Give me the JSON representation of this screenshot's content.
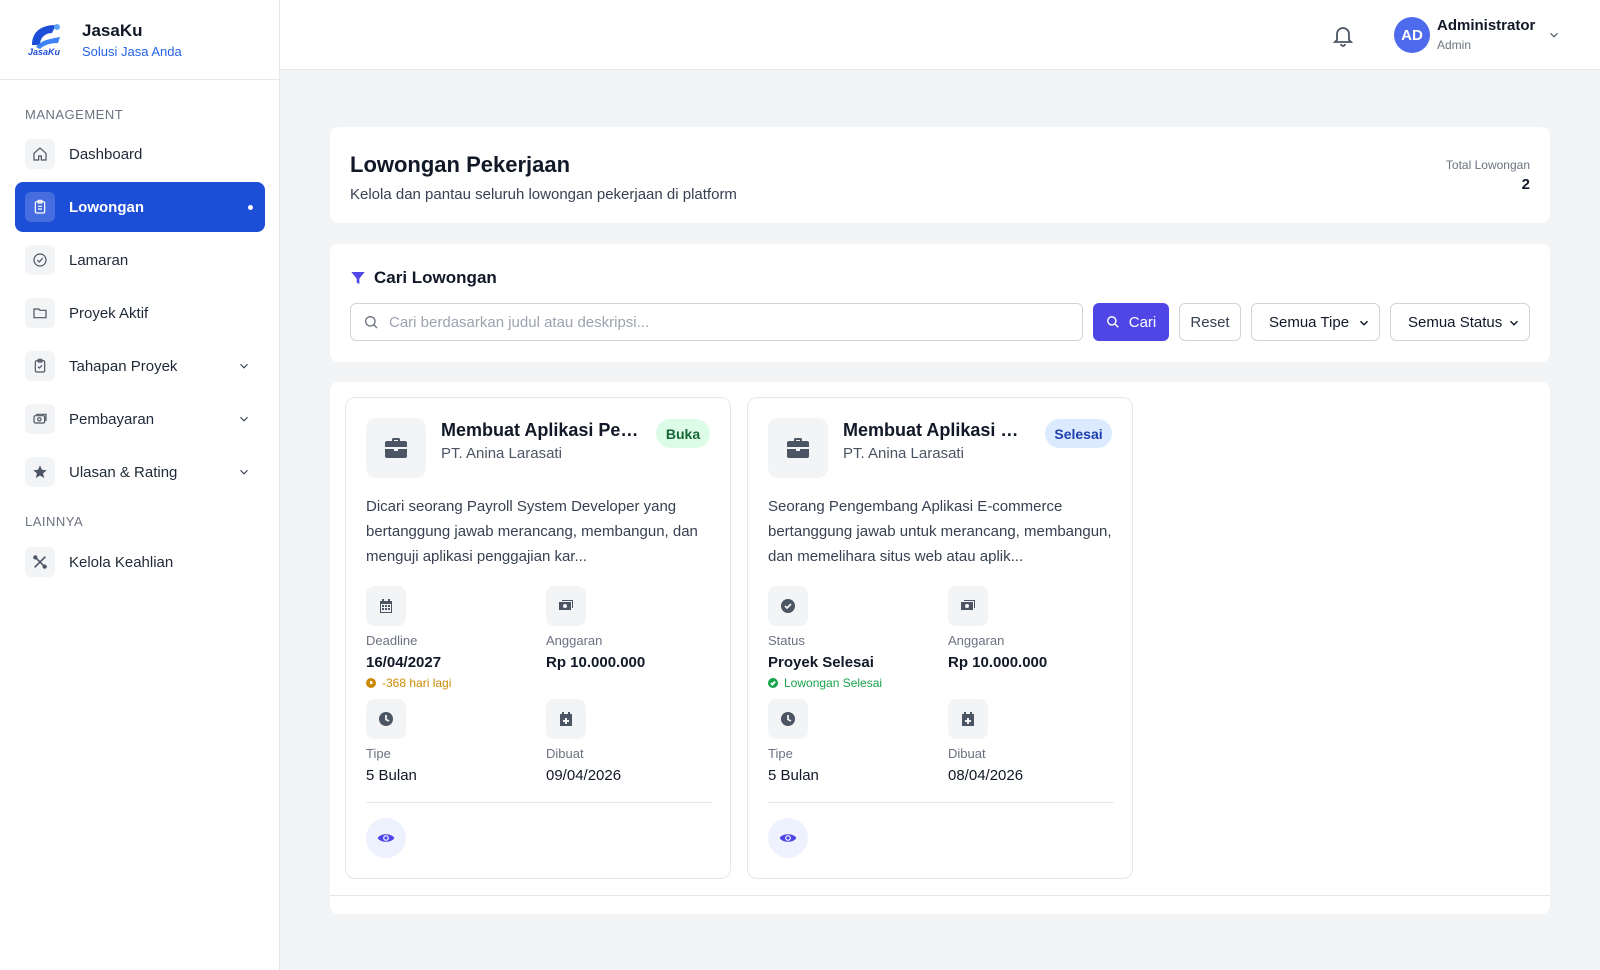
{
  "brand": {
    "name": "JasaKu",
    "tagline": "Solusi Jasa Anda",
    "logo_text": "JasaKu"
  },
  "sidebar": {
    "section_management": "MANAGEMENT",
    "section_other": "LAINNYA",
    "items": [
      {
        "label": "Dashboard",
        "icon": "home-icon"
      },
      {
        "label": "Lowongan",
        "icon": "clipboard-icon",
        "active": true
      },
      {
        "label": "Lamaran",
        "icon": "check-circle-icon"
      },
      {
        "label": "Proyek Aktif",
        "icon": "folder-icon"
      },
      {
        "label": "Tahapan Proyek",
        "icon": "clipboard-check-icon",
        "expandable": true
      },
      {
        "label": "Pembayaran",
        "icon": "money-icon",
        "expandable": true
      },
      {
        "label": "Ulasan & Rating",
        "icon": "star-icon",
        "expandable": true
      },
      {
        "label": "Kelola Keahlian",
        "icon": "tools-icon"
      }
    ]
  },
  "topbar": {
    "avatar_initials": "AD",
    "user_name": "Administrator",
    "user_role": "Admin"
  },
  "header": {
    "title": "Lowongan Pekerjaan",
    "subtitle": "Kelola dan pantau seluruh lowongan pekerjaan di platform",
    "total_label": "Total Lowongan",
    "total_value": "2"
  },
  "search": {
    "title": "Cari Lowongan",
    "placeholder": "Cari berdasarkan judul atau deskripsi...",
    "value": "",
    "search_button": "Cari",
    "reset_button": "Reset",
    "type_filter": "Semua Tipe",
    "status_filter": "Semua Status"
  },
  "jobs": [
    {
      "title": "Membuat Aplikasi Peng...",
      "company": "PT. Anina Larasati",
      "badge": "Buka",
      "description": "Dicari seorang Payroll System Developer yang bertanggung jawab merancang, membangun, dan menguji aplikasi penggajian kar...",
      "meta1_label": "Deadline",
      "meta1_value": "16/04/2027",
      "meta1_note": "-368 hari lagi",
      "budget_label": "Anggaran",
      "budget_value": "Rp 10.000.000",
      "type_label": "Tipe",
      "type_value": "5 Bulan",
      "created_label": "Dibuat",
      "created_value": "09/04/2026"
    },
    {
      "title": "Membuat Aplikasi We...",
      "company": "PT. Anina Larasati",
      "badge": "Selesai",
      "description": "Seorang Pengembang Aplikasi E-commerce bertanggung jawab untuk merancang, membangun, dan memelihara situs web atau aplik...",
      "meta1_label": "Status",
      "meta1_value": "Proyek Selesai",
      "meta1_note": "Lowongan Selesai",
      "budget_label": "Anggaran",
      "budget_value": "Rp 10.000.000",
      "type_label": "Tipe",
      "type_value": "5 Bulan",
      "created_label": "Dibuat",
      "created_value": "08/04/2026"
    }
  ],
  "colors": {
    "primary": "#1d4ed8",
    "accent": "#4f46e5",
    "open_badge": "#dcfce7",
    "done_badge": "#dbeafe"
  }
}
